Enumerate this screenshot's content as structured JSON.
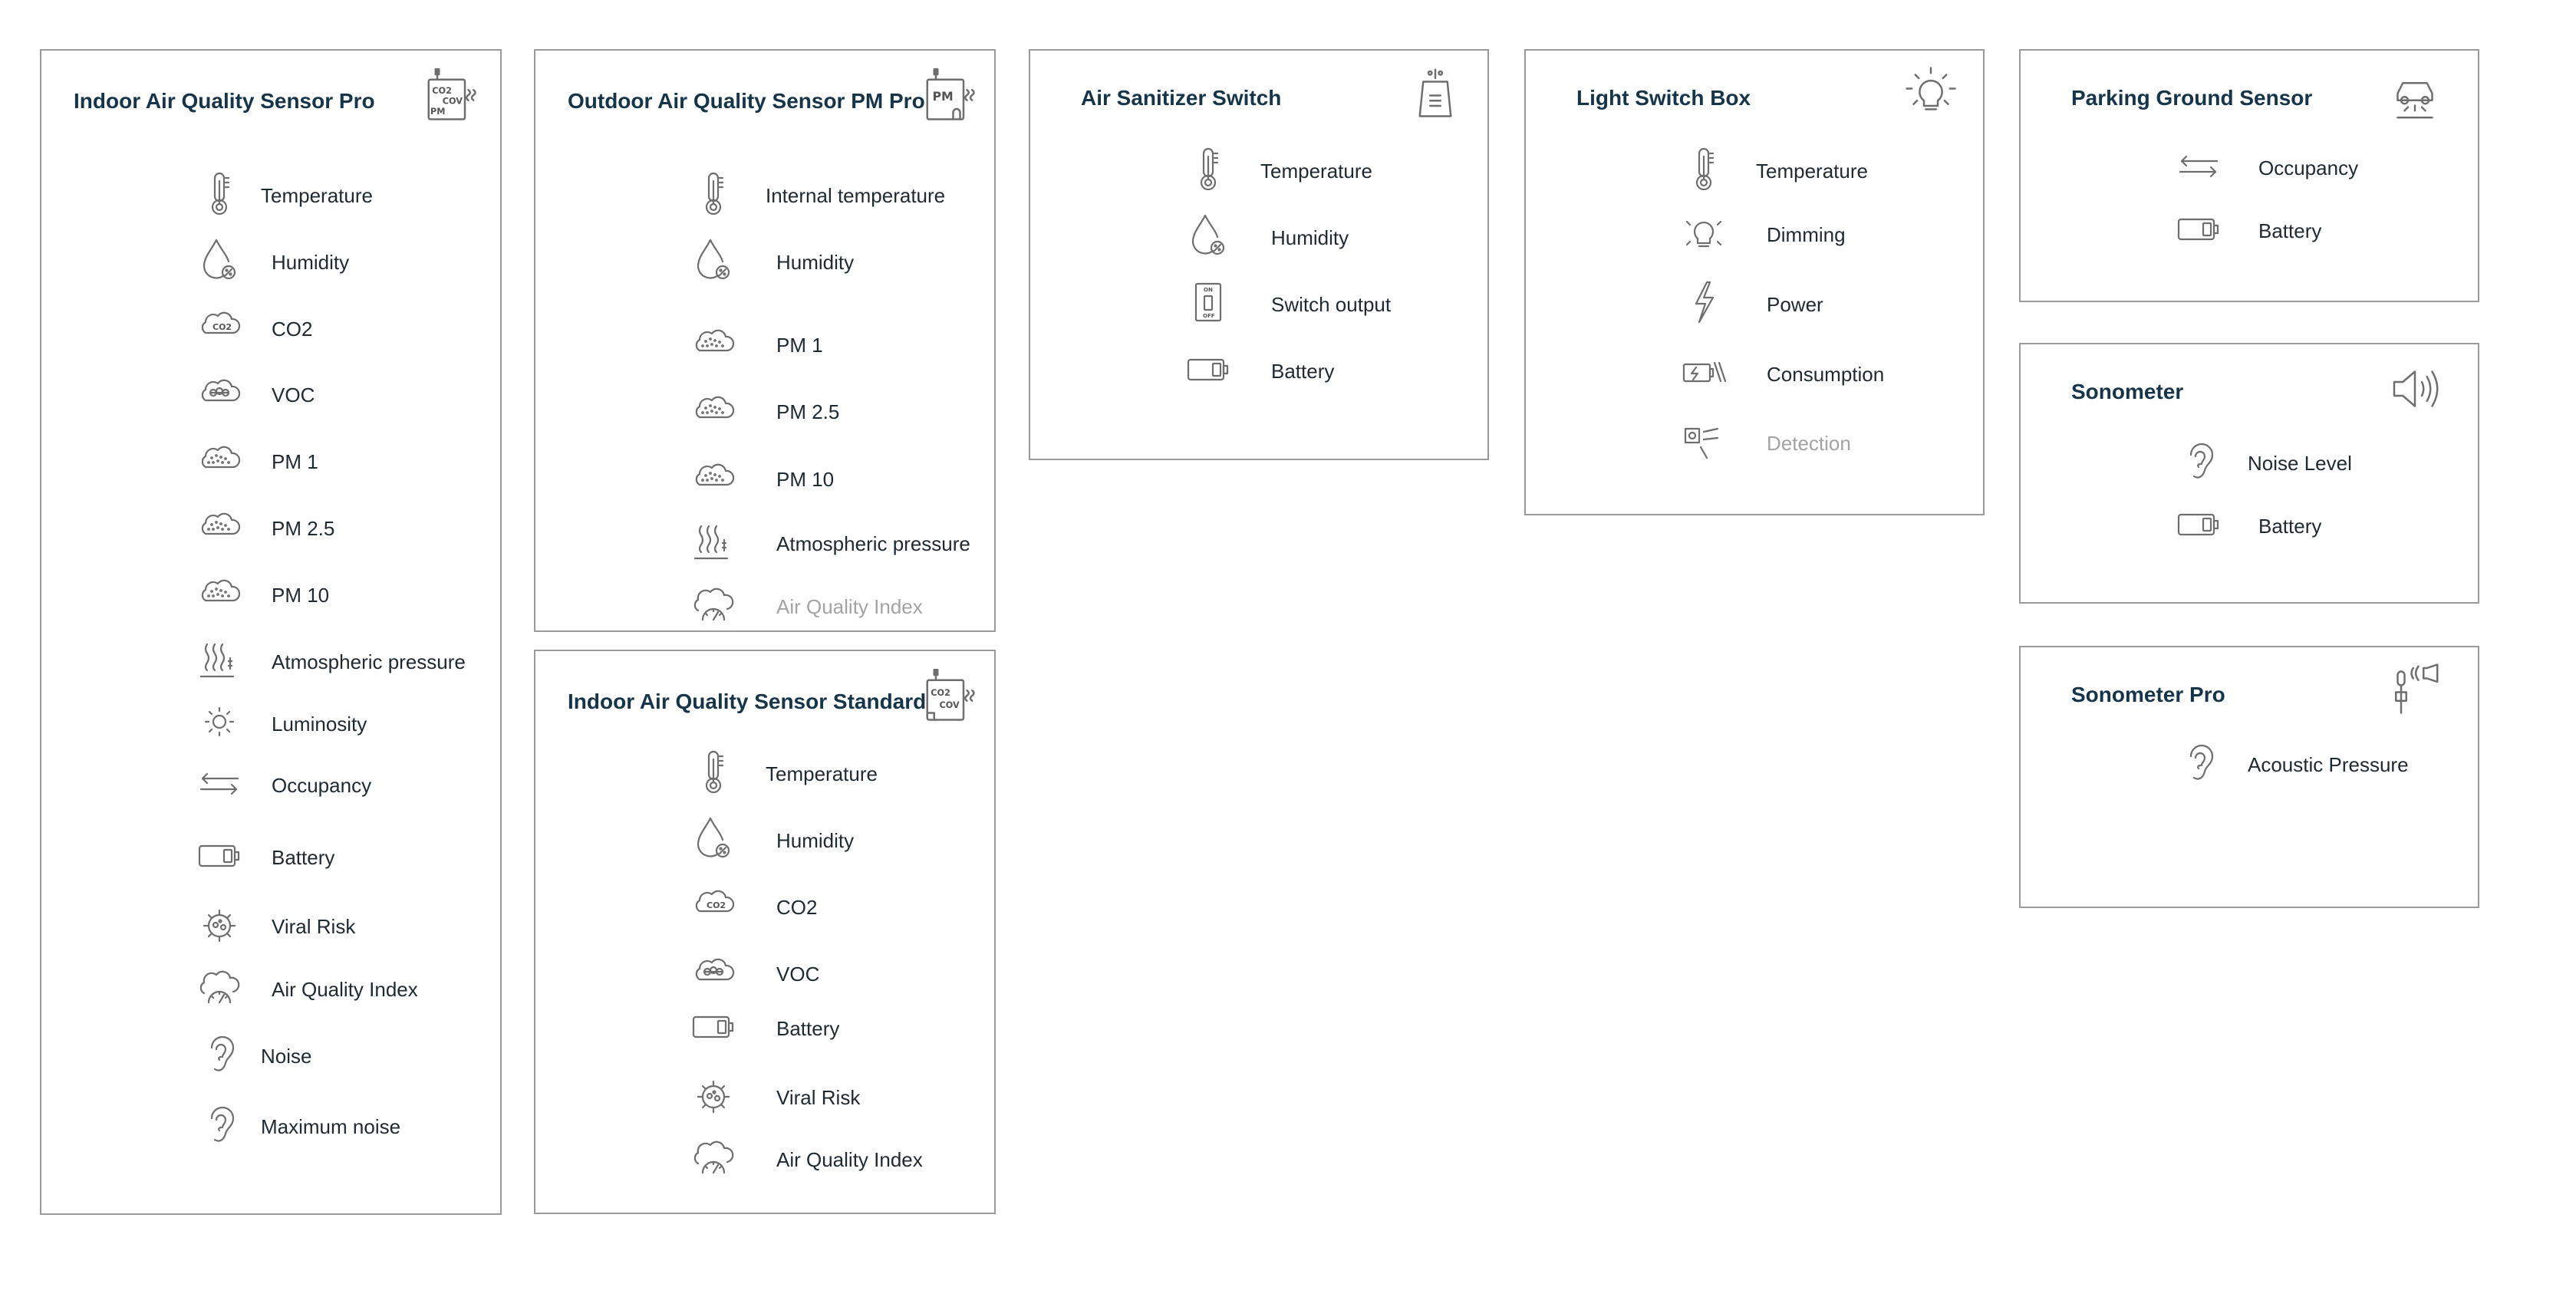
{
  "icon_color": "#6e6e6e",
  "title_color": "#173548",
  "border_color": "#9a9a9a",
  "cards": [
    {
      "title": "Indoor Air Quality Sensor Pro",
      "icon": "co2-cov-pm-sensor-icon",
      "icon_text": [
        "CO2",
        "COV",
        "PM"
      ],
      "rows": [
        {
          "label": "Temperature",
          "icon": "thermometer-icon"
        },
        {
          "label": "Humidity",
          "icon": "humidity-drop-icon"
        },
        {
          "label": "CO2",
          "icon": "co2-cloud-icon"
        },
        {
          "label": "VOC",
          "icon": "voc-cloud-icon"
        },
        {
          "label": "PM 1",
          "icon": "pm-cloud-icon"
        },
        {
          "label": "PM 2.5",
          "icon": "pm-cloud-icon"
        },
        {
          "label": "PM 10",
          "icon": "pm-cloud-icon"
        },
        {
          "label": "Atmospheric pressure",
          "icon": "pressure-waves-icon"
        },
        {
          "label": "Luminosity",
          "icon": "sun-icon"
        },
        {
          "label": "Occupancy",
          "icon": "arrows-icon"
        },
        {
          "label": "Battery",
          "icon": "battery-icon"
        },
        {
          "label": "Viral Risk",
          "icon": "virus-icon"
        },
        {
          "label": "Air Quality Index",
          "icon": "aqi-gauge-icon"
        },
        {
          "label": "Noise",
          "icon": "ear-icon"
        },
        {
          "label": "Maximum noise",
          "icon": "ear-icon"
        }
      ]
    },
    {
      "title": "Outdoor Air Quality Sensor PM Pro",
      "icon": "pm-sensor-icon",
      "icon_text": [
        "PM"
      ],
      "rows": [
        {
          "label": "Internal temperature",
          "icon": "thermometer-icon"
        },
        {
          "label": "Humidity",
          "icon": "humidity-drop-icon"
        },
        {
          "label": "PM 1",
          "icon": "pm-cloud-icon"
        },
        {
          "label": "PM 2.5",
          "icon": "pm-cloud-icon"
        },
        {
          "label": "PM 10",
          "icon": "pm-cloud-icon"
        },
        {
          "label": "Atmospheric pressure",
          "icon": "pressure-waves-icon"
        },
        {
          "label": "Air Quality Index",
          "icon": "aqi-gauge-icon",
          "muted": true
        }
      ]
    },
    {
      "title": "Indoor Air Quality Sensor Standard",
      "icon": "co2-cov-sensor-icon",
      "icon_text": [
        "CO2",
        "COV"
      ],
      "rows": [
        {
          "label": "Temperature",
          "icon": "thermometer-icon"
        },
        {
          "label": "Humidity",
          "icon": "humidity-drop-icon"
        },
        {
          "label": "CO2",
          "icon": "co2-cloud-icon"
        },
        {
          "label": "VOC",
          "icon": "voc-cloud-icon"
        },
        {
          "label": "Battery",
          "icon": "battery-icon"
        },
        {
          "label": "Viral Risk",
          "icon": "virus-icon"
        },
        {
          "label": "Air Quality Index",
          "icon": "aqi-gauge-icon"
        }
      ]
    },
    {
      "title": "Air Sanitizer Switch",
      "icon": "sanitizer-device-icon",
      "rows": [
        {
          "label": "Temperature",
          "icon": "thermometer-icon"
        },
        {
          "label": "Humidity",
          "icon": "humidity-drop-icon"
        },
        {
          "label": "Switch output",
          "icon": "switch-icon"
        },
        {
          "label": "Battery",
          "icon": "battery-icon"
        }
      ]
    },
    {
      "title": "Light Switch Box",
      "icon": "light-bulb-icon",
      "rows": [
        {
          "label": "Temperature",
          "icon": "thermometer-icon"
        },
        {
          "label": "Dimming",
          "icon": "bulb-dimming-icon"
        },
        {
          "label": "Power",
          "icon": "lightning-icon"
        },
        {
          "label": "Consumption",
          "icon": "consumption-icon"
        },
        {
          "label": "Detection",
          "icon": "detection-icon",
          "muted": true
        }
      ]
    },
    {
      "title": "Parking Ground Sensor",
      "icon": "car-sensor-icon",
      "rows": [
        {
          "label": "Occupancy",
          "icon": "arrows-icon"
        },
        {
          "label": "Battery",
          "icon": "battery-icon"
        }
      ]
    },
    {
      "title": "Sonometer",
      "icon": "speaker-icon",
      "rows": [
        {
          "label": "Noise Level",
          "icon": "ear-icon"
        },
        {
          "label": "Battery",
          "icon": "battery-icon"
        }
      ]
    },
    {
      "title": "Sonometer Pro",
      "icon": "microphone-speaker-icon",
      "rows": [
        {
          "label": "Acoustic Pressure",
          "icon": "ear-icon"
        }
      ]
    }
  ]
}
